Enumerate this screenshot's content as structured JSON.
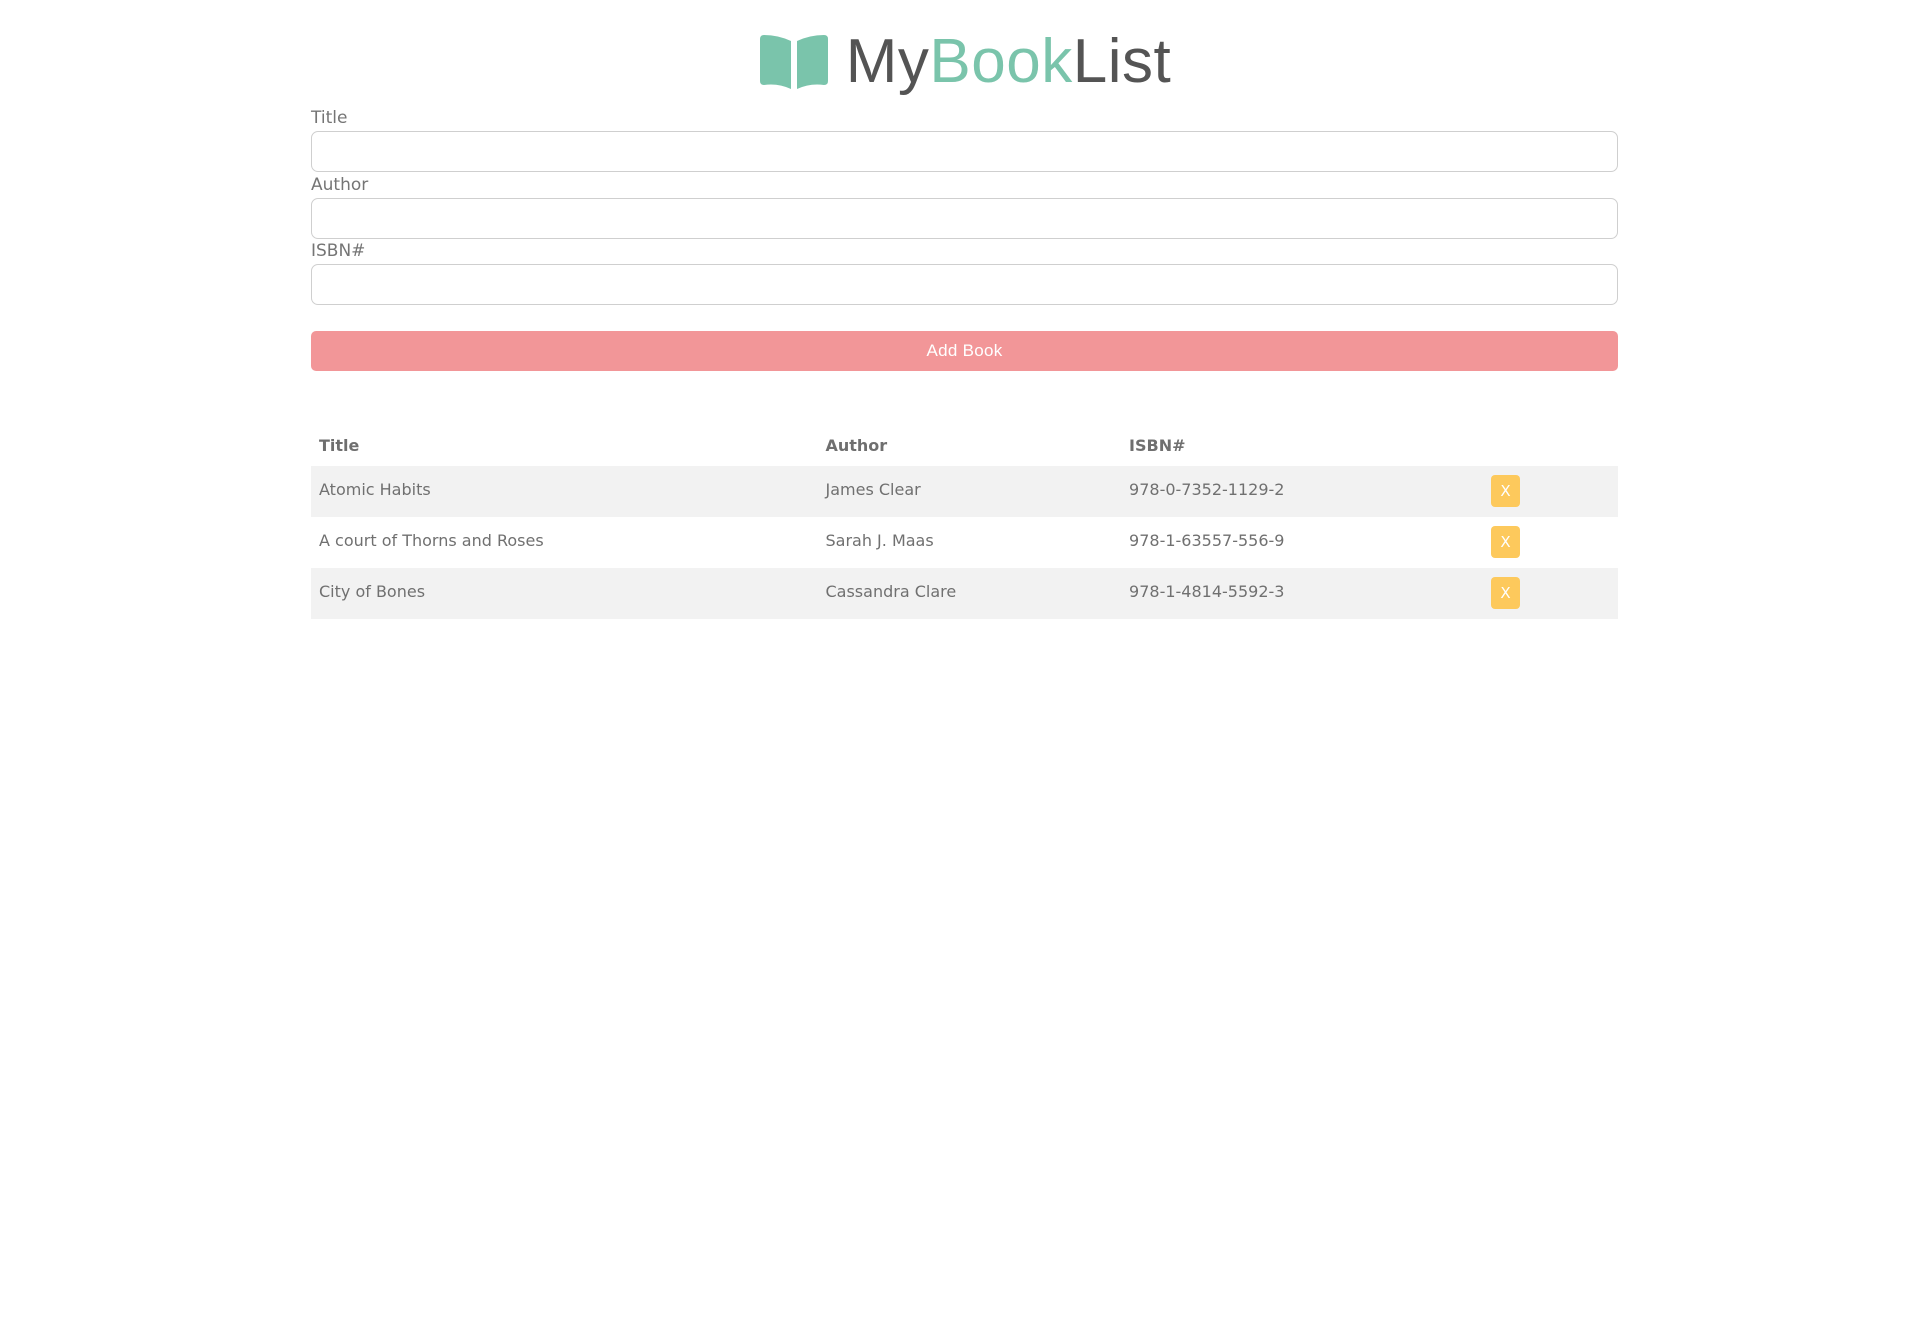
{
  "header": {
    "logo_icon": "open-book-icon",
    "title_part1": "My",
    "title_part2": "Book",
    "title_part3": "List",
    "colors": {
      "accent": "#7ac4ab",
      "title_dark": "#545454"
    }
  },
  "form": {
    "title_label": "Title",
    "title_value": "",
    "author_label": "Author",
    "author_value": "",
    "isbn_label": "ISBN#",
    "isbn_value": "",
    "submit_label": "Add Book",
    "submit_color": "#f29698"
  },
  "table": {
    "headers": {
      "title": "Title",
      "author": "Author",
      "isbn": "ISBN#"
    },
    "rows": [
      {
        "title": "Atomic Habits",
        "author": "James Clear",
        "isbn": "978-0-7352-1129-2",
        "delete_label": "X"
      },
      {
        "title": "A court of Thorns and Roses",
        "author": "Sarah J. Maas",
        "isbn": "978-1-63557-556-9",
        "delete_label": "X"
      },
      {
        "title": "City of Bones",
        "author": "Cassandra Clare",
        "isbn": "978-1-4814-5592-3",
        "delete_label": "X"
      }
    ],
    "delete_color": "#fdc95c"
  }
}
